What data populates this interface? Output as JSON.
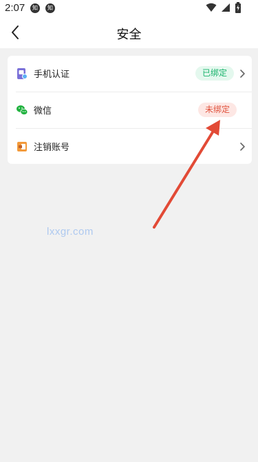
{
  "status_bar": {
    "time": "2:07",
    "notifications": [
      "知",
      "知"
    ]
  },
  "header": {
    "title": "安全"
  },
  "security_list": {
    "items": [
      {
        "label": "手机认证",
        "icon": "phone-verify-icon",
        "badge": "已绑定",
        "has_chevron": true
      },
      {
        "label": "微信",
        "icon": "wechat-icon",
        "badge": "未绑定",
        "has_chevron": false
      },
      {
        "label": "注销账号",
        "icon": "cancel-account-icon",
        "badge": "",
        "has_chevron": true
      }
    ]
  },
  "watermark": "lxxgr.com",
  "colors": {
    "bound_badge_text": "#19b36c",
    "bound_badge_bg": "#e4f8ee",
    "unbound_badge_text": "#e0523d",
    "unbound_badge_bg": "#fde7e4",
    "annotation_arrow": "#e24a36",
    "wechat": "#22b340",
    "account_icon": "#f39a3a",
    "phone_icon": "#7a70d8"
  }
}
